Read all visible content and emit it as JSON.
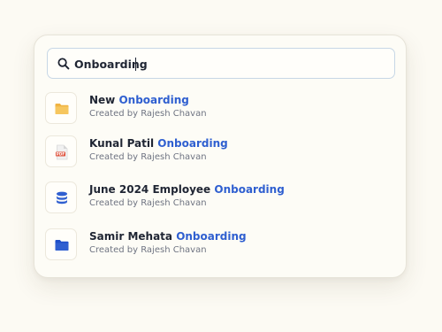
{
  "search": {
    "value": "Onboarding",
    "icon": "search-icon"
  },
  "colors": {
    "highlight": "#2f5fd0",
    "background": "#fcfaf3"
  },
  "results": [
    {
      "icon": "folder-icon",
      "title_prefix": "New ",
      "title_match": "Onboarding",
      "subtitle": "Created by Rajesh Chavan"
    },
    {
      "icon": "pdf-file-icon",
      "title_prefix": "Kunal Patil ",
      "title_match": "Onboarding",
      "subtitle": "Created by Rajesh Chavan"
    },
    {
      "icon": "database-icon",
      "title_prefix": "June 2024 Employee ",
      "title_match": "Onboarding",
      "subtitle": "Created by Rajesh Chavan"
    },
    {
      "icon": "folder-icon",
      "title_prefix": "Samir Mehata ",
      "title_match": "Onboarding",
      "subtitle": "Created by Rajesh Chavan"
    }
  ]
}
